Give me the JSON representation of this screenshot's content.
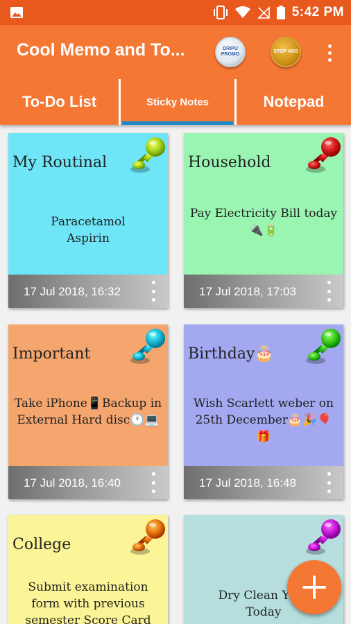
{
  "status_bar": {
    "time": "5:42 PM"
  },
  "app_bar": {
    "title": "Cool Memo and To...",
    "promo_badge_text": "DRIPU PROMO",
    "stop_ads_text": "STOP ADS"
  },
  "tabs": [
    {
      "label": "To-Do List",
      "selected": false
    },
    {
      "label": "Sticky Notes",
      "selected": true
    },
    {
      "label": "Notepad",
      "selected": false
    }
  ],
  "notes": [
    {
      "title": "My Routinal",
      "body": "Paracetamol\nAspirin",
      "date": "17 Jul 2018, 16:32",
      "color": "#6ee6f7",
      "pin_color": "#a6d41a"
    },
    {
      "title": "Household",
      "body": "Pay Electricity Bill today\n🔌🔋",
      "date": "17 Jul 2018, 17:03",
      "color": "#99f5b1",
      "pin_color": "#d41a1a"
    },
    {
      "title": "Important",
      "body": "Take iPhone📱Backup in\nExternal Hard disc🕐💻",
      "date": "17 Jul 2018, 16:40",
      "color": "#f5a66e",
      "pin_color": "#1ab8d4"
    },
    {
      "title": "Birthday🎂",
      "body": "Wish Scarlett weber on\n25th December🎂🎉🎈🎁",
      "date": "17 Jul 2018, 16:48",
      "color": "#a3a8f0",
      "pin_color": "#3cc81a"
    },
    {
      "title": "College",
      "body": "Submit examination\nform with previous\nsemester Score Card",
      "date": "",
      "color": "#fbf597",
      "pin_color": "#e8760f"
    },
    {
      "title": "",
      "body": "Dry Clean Your\nToday",
      "date": "",
      "color": "#b6dedd",
      "pin_color": "#c41ad4"
    }
  ],
  "fab": {
    "icon": "plus-icon",
    "color": "#f47734"
  },
  "colors": {
    "status_bar": "#e8591e",
    "app_bar": "#f47734",
    "tab_indicator": "#1e88c7"
  }
}
